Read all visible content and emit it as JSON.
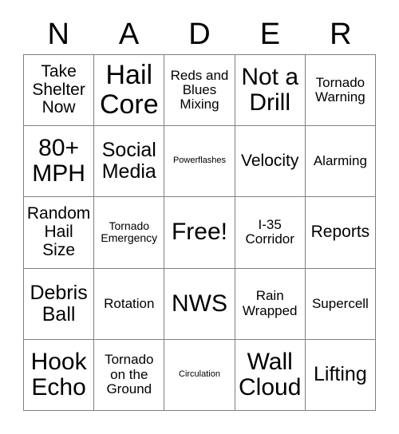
{
  "card": {
    "title_letters": [
      "N",
      "A",
      "D",
      "E",
      "R"
    ],
    "free_space_label": "Free!",
    "colors": {
      "background": "#ffffff",
      "cell_background": "#ffffff",
      "border": "#808080",
      "text": "#000000"
    },
    "grid": {
      "columns": 5,
      "rows": 5,
      "cells": [
        {
          "text": "Take Shelter Now",
          "size": "sm"
        },
        {
          "text": "Hail Core",
          "size": "xl"
        },
        {
          "text": "Reds and Blues Mixing",
          "size": "xs"
        },
        {
          "text": "Not a Drill",
          "size": "lg"
        },
        {
          "text": "Tornado Warning",
          "size": "xs"
        },
        {
          "text": "80+ MPH",
          "size": "lg"
        },
        {
          "text": "Social Media",
          "size": "md"
        },
        {
          "text": "Powerflashes",
          "size": "tiny"
        },
        {
          "text": "Velocity",
          "size": "sm"
        },
        {
          "text": "Alarming",
          "size": "xs"
        },
        {
          "text": "Random Hail Size",
          "size": "sm"
        },
        {
          "text": "Tornado Emergency",
          "size": "xxs"
        },
        {
          "text": "Free!",
          "size": "lg"
        },
        {
          "text": "I-35 Corridor",
          "size": "xs"
        },
        {
          "text": "Reports",
          "size": "sm"
        },
        {
          "text": "Debris Ball",
          "size": "md"
        },
        {
          "text": "Rotation",
          "size": "xs"
        },
        {
          "text": "NWS",
          "size": "lg"
        },
        {
          "text": "Rain Wrapped",
          "size": "xs"
        },
        {
          "text": "Supercell",
          "size": "xs"
        },
        {
          "text": "Hook Echo",
          "size": "lg"
        },
        {
          "text": "Tornado on the Ground",
          "size": "xs"
        },
        {
          "text": "Circulation",
          "size": "tiny"
        },
        {
          "text": "Wall Cloud",
          "size": "lg"
        },
        {
          "text": "Lifting",
          "size": "md"
        }
      ]
    }
  }
}
